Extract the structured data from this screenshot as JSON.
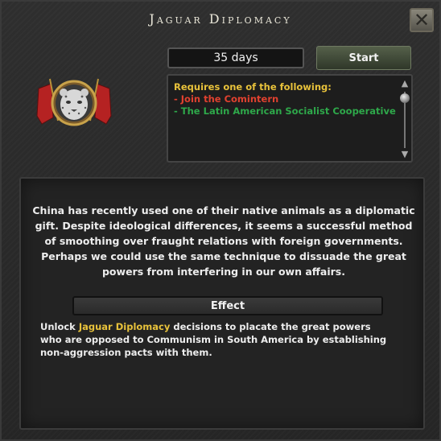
{
  "window": {
    "title": "Jaguar Diplomacy",
    "close_icon": "close-x-icon"
  },
  "decision": {
    "duration": "35 days",
    "start_label": "Start",
    "emblem_icon": "jaguar-head-emblem-icon"
  },
  "requirements": {
    "title": "Requires one of the following:",
    "items": [
      {
        "text": "- Join the Comintern",
        "status": "unmet",
        "color": "#e0412f"
      },
      {
        "text": "- The Latin American Socialist Cooperative",
        "status": "met",
        "color": "#2ea84a"
      }
    ]
  },
  "description": "China has recently used one of their native animals as a diplomatic gift. Despite ideological differences, it seems a successful method of smoothing over fraught relations with foreign governments. Perhaps we could use the same technique to dissuade the great powers from interfering in our own affairs.",
  "effect": {
    "header": "Effect",
    "prefix": "Unlock ",
    "highlight": "Jaguar Diplomacy",
    "suffix": " decisions to placate the great powers who are opposed to Communism in South America by establishing non-aggression pacts with them."
  },
  "colors": {
    "highlight": "#e8c23b",
    "unmet": "#e0412f",
    "met": "#2ea84a"
  }
}
